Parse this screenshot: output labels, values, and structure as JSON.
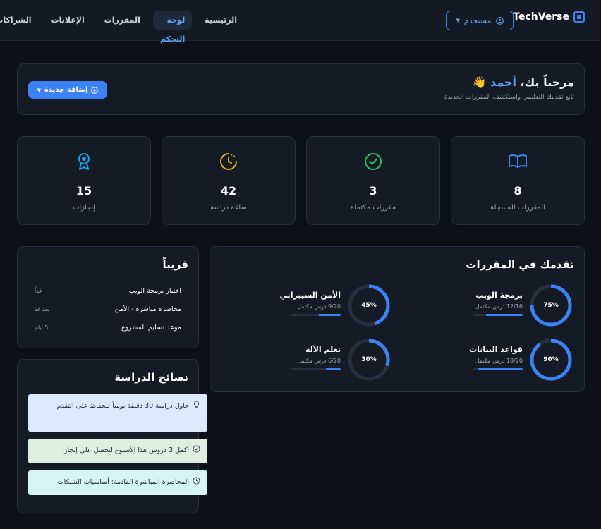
{
  "nav": {
    "brand": "TechVerse",
    "user_label": "مستخدم",
    "links": [
      {
        "label": "الرئيسية",
        "active": false
      },
      {
        "label": "لوحة التحكم",
        "active": true
      },
      {
        "label": "المقررات",
        "active": false
      },
      {
        "label": "الإعلانات",
        "active": false
      },
      {
        "label": "الشراكات",
        "active": false
      }
    ]
  },
  "welcome": {
    "greeting": "مرحباً بك،",
    "name": "أحمد",
    "emoji": "👋",
    "subtitle": "تابع تقدمك التعليمي واستكشف المقررات الجديدة",
    "add_button": "إضافة جديدة"
  },
  "stats": [
    {
      "value": "8",
      "label": "المقررات المسجلة",
      "icon": "book-icon",
      "color": "#3b82f6"
    },
    {
      "value": "3",
      "label": "مقررات مكتملة",
      "icon": "check-circle-icon",
      "color": "#22c55e"
    },
    {
      "value": "42",
      "label": "ساعة دراسة",
      "icon": "clock-icon",
      "color": "#eab308"
    },
    {
      "value": "15",
      "label": "إنجازات",
      "icon": "award-icon",
      "color": "#0ea5e9"
    }
  ],
  "progress": {
    "title": "تقدمك في المقررات",
    "courses": [
      {
        "name": "برمجة الويب",
        "progress": "12/16 درس مكتمل",
        "pct_label": "75%",
        "pct": 0.75
      },
      {
        "name": "الأمن السيبراني",
        "progress": "9/20 درس مكتمل",
        "pct_label": "45%",
        "pct": 0.45
      },
      {
        "name": "قواعد البيانات",
        "progress": "18/20 درس مكتمل",
        "pct_label": "90%",
        "pct": 0.9
      },
      {
        "name": "تعلم الآلة",
        "progress": "6/20 درس مكتمل",
        "pct_label": "30%",
        "pct": 0.3
      }
    ]
  },
  "upcoming": {
    "title": "قريباً",
    "items": [
      {
        "title": "اختبار برمجة الويب",
        "time": "غداً"
      },
      {
        "title": "محاضرة مباشرة - الأمن",
        "time": "بعد غد"
      },
      {
        "title": "موعد تسليم المشروع",
        "time": "5 أيام"
      }
    ]
  },
  "tips": {
    "title": "نصائح الدراسة",
    "items": [
      {
        "text": "حاول دراسة 30 دقيقة يومياً للحفاظ على التقدم",
        "icon": "lightbulb-icon",
        "bg": "#dbeafe"
      },
      {
        "text": "أكمل 3 دروس هذا الأسبوع لتحصل على إنجاز",
        "icon": "check-circle-icon",
        "bg": "#dcefe0"
      },
      {
        "text": "المحاضرة المباشرة القادمة: أساسيات الشبكات",
        "icon": "clock-icon",
        "bg": "#d6f3f7"
      }
    ]
  },
  "colors": {
    "accent": "#3b82f6",
    "background": "#0d1117",
    "card": "#151b25"
  }
}
